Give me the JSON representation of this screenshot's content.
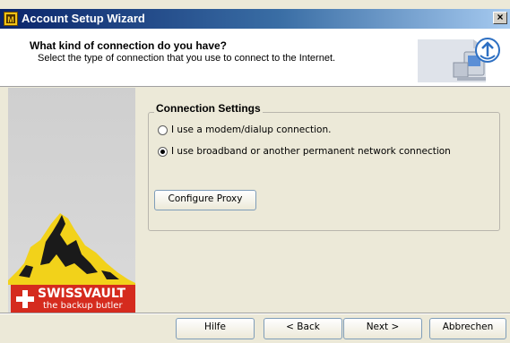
{
  "window": {
    "title": "Account Setup Wizard",
    "close_label": "×"
  },
  "header": {
    "title": "What kind of connection do you have?",
    "subtitle": "Select the type of connection that you use to connect to the Internet."
  },
  "logo": {
    "brand": "SWISSVAULT",
    "tagline": "the backup butler"
  },
  "connection_settings": {
    "group_title": "Connection Settings",
    "options": [
      {
        "label": "I use a modem/dialup connection.",
        "selected": false
      },
      {
        "label": "I use broadband or another permanent network connection",
        "selected": true
      }
    ],
    "proxy_button": "Configure Proxy"
  },
  "footer": {
    "help_label": "Hilfe",
    "back_label": "< Back",
    "next_label": "Next >",
    "cancel_label": "Abbrechen"
  },
  "colors": {
    "titlebar_start": "#0a246a",
    "titlebar_end": "#a6caf0",
    "dialog_bg": "#ece9d8",
    "swiss_red": "#d52b1e"
  },
  "icons": [
    "app-icon",
    "close-icon",
    "network-computer-icon",
    "matterhorn-logo",
    "swiss-cross-icon"
  ]
}
